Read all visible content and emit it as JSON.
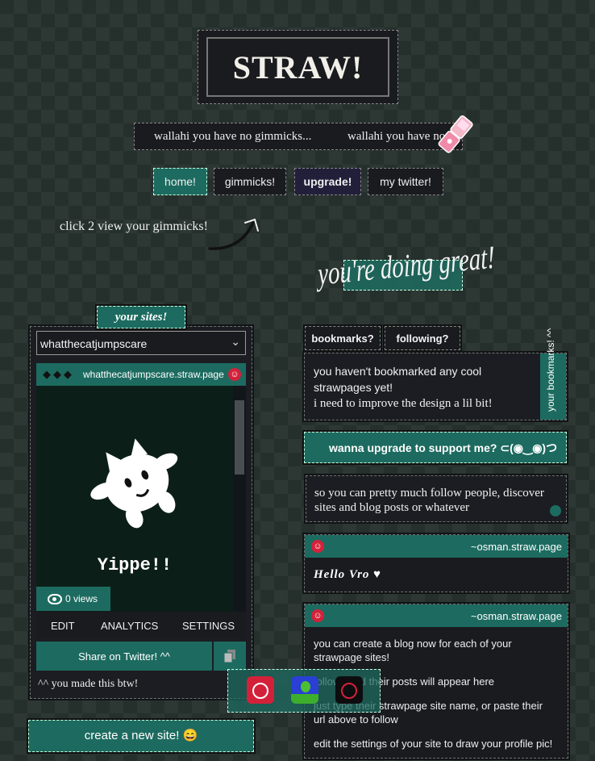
{
  "header": {
    "logo_text": "STRAW!",
    "marquee": [
      "wallahi you have no gimmicks...",
      "wallahi you have no gimmicks..."
    ]
  },
  "nav": {
    "home": "home!",
    "gimmicks": "gimmicks!",
    "upgrade": "upgrade!",
    "twitter": "my twitter!"
  },
  "hint": "click 2 view your gimmicks!",
  "greeting": "you're doing great!",
  "sites": {
    "tab_label": "your sites!",
    "selected_site": "whatthecatjumpscare",
    "preview_url": "whatthecatjumpscare.straw.page",
    "preview_caption": "Yippe!!",
    "views": "0 views",
    "tabs": [
      "EDIT",
      "ANALYTICS",
      "SETTINGS"
    ],
    "share_label": "Share on Twitter! ^^",
    "made_note": "^^ you made this btw!",
    "create_label": "create a new site! 😄"
  },
  "right": {
    "tabs": [
      "bookmarks?",
      "following?"
    ],
    "bookmarks_text": [
      "you haven't bookmarked any cool strawpages yet!",
      "i need to improve the design a lil bit!"
    ],
    "side_label": "your bookmarks! ^^",
    "upgrade_text": "wanna upgrade to support me? ⊂(◉‿◉)つ",
    "follow_info": "so you can pretty much follow people, discover sites and blog posts or whatever",
    "posts": [
      {
        "author": "~osman.straw.page",
        "text": "Hello Vro ♥"
      },
      {
        "author": "~osman.straw.page",
        "paragraphs": [
          "you can create a blog now for each of your strawpage sites!",
          "follows and their posts will appear here",
          "just type their strawpage site name, or paste their url above to follow",
          "edit the settings of your site to draw your profile pic!"
        ]
      }
    ]
  },
  "colors": {
    "accent": "#1d6b60",
    "panel": "#1a1b1f",
    "background": "#25302d",
    "smiley": "#d4213a"
  }
}
